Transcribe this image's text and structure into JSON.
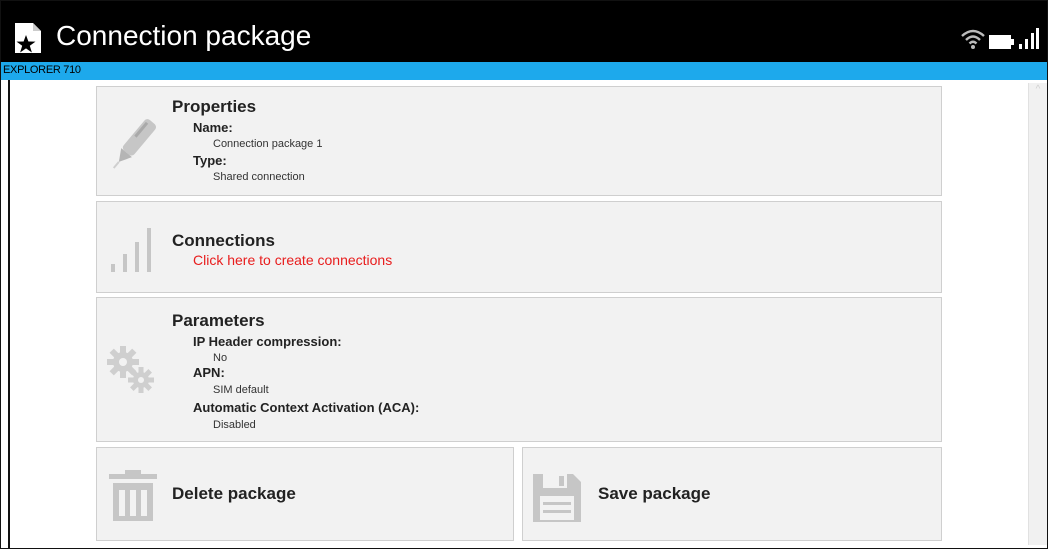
{
  "app": {
    "title": "Connection package",
    "device_name": "EXPLORER 710"
  },
  "icons": {
    "app": "sim-star-icon",
    "wifi": "wifi-icon",
    "battery": "battery-icon",
    "signal": "signal-bars-icon",
    "properties": "pen-icon",
    "connections": "signal-bars-icon",
    "parameters": "gears-icon",
    "delete": "trash-icon",
    "save": "floppy-disk-icon"
  },
  "properties": {
    "title": "Properties",
    "name_label": "Name:",
    "name_value": "Connection package 1",
    "type_label": "Type:",
    "type_value": "Shared connection"
  },
  "connections": {
    "title": "Connections",
    "create_link": "Click here to create connections"
  },
  "parameters": {
    "title": "Parameters",
    "ip_header_label": "IP Header compression:",
    "ip_header_value": "No",
    "apn_label": "APN:",
    "apn_value": "SIM default",
    "aca_label": "Automatic Context Activation (ACA):",
    "aca_value": "Disabled"
  },
  "actions": {
    "delete_label": "Delete package",
    "save_label": "Save package"
  },
  "colors": {
    "titlebar": "#000000",
    "devicebar": "#1da9ec",
    "card_background": "#f2f2f2",
    "link": "#e81c1c",
    "icon_gray": "#bdbdbd"
  }
}
